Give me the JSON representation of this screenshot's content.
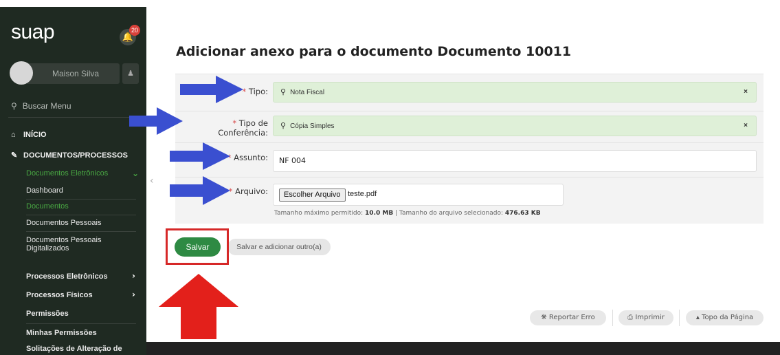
{
  "sidebar": {
    "logo": "suap",
    "notification_count": "20",
    "user_name": "Maison Silva",
    "search_label": "Buscar Menu",
    "items": [
      {
        "label": "INÍCIO"
      },
      {
        "label": "DOCUMENTOS/PROCESSOS"
      }
    ],
    "sub_items": [
      {
        "label": "Documentos Eletrônicos"
      },
      {
        "label": "Dashboard"
      },
      {
        "label": "Documentos"
      },
      {
        "label": "Documentos Pessoais"
      },
      {
        "label": "Documentos Pessoais Digitalizados"
      },
      {
        "label": "Processos Eletrônicos"
      },
      {
        "label": "Processos Físicos"
      },
      {
        "label": "Permissões"
      },
      {
        "label": "Minhas Permissões"
      },
      {
        "label": "Solitações de Alteração de"
      }
    ]
  },
  "page": {
    "title": "Adicionar anexo para o documento Documento 10011"
  },
  "form": {
    "required_mark": "*",
    "tipo_label": "Tipo:",
    "tipo_value": "Nota Fiscal",
    "conferencia_label": "Tipo de Conferência:",
    "conferencia_value": "Cópia Simples",
    "assunto_label": "Assunto:",
    "assunto_value": "NF 004",
    "arquivo_label": "Arquivo:",
    "file_button": "Escolher Arquivo",
    "file_name": "teste.pdf",
    "help_prefix": "Tamanho máximo permitido:",
    "help_max": "10.0 MB",
    "help_mid": "| Tamanho do arquivo selecionado:",
    "help_size": "476.63 KB",
    "clear_symbol": "×"
  },
  "actions": {
    "save": "Salvar",
    "save_add": "Salvar e adicionar outro(a)"
  },
  "footer": {
    "report": "Reportar Erro",
    "print": "Imprimir",
    "top": "Topo da Página"
  },
  "colors": {
    "sidebar_bg": "#1f2a22",
    "accent_green": "#2e8a43",
    "select_green": "#dff0d8",
    "annotation_blue": "#3a4fd0",
    "annotation_red": "#e3201b"
  }
}
